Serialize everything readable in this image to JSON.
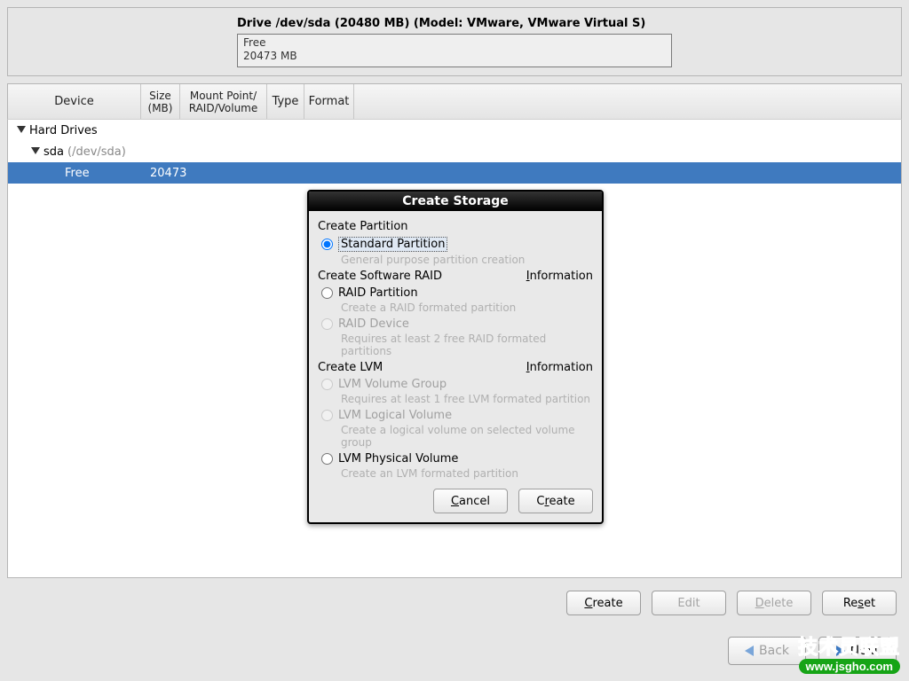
{
  "drive": {
    "title": "Drive /dev/sda (20480 MB) (Model: VMware, VMware Virtual S)",
    "box_line1": "Free",
    "box_line2": "20473 MB"
  },
  "columns": {
    "device": "Device",
    "size_l1": "Size",
    "size_l2": "(MB)",
    "mount_l1": "Mount Point/",
    "mount_l2": "RAID/Volume",
    "type": "Type",
    "format": "Format"
  },
  "tree": {
    "root": "Hard Drives",
    "sda": "sda",
    "sda_path": "(/dev/sda)",
    "free_label": "Free",
    "free_size": "20473"
  },
  "actions": {
    "create": "Create",
    "edit": "Edit",
    "delete": "Delete",
    "reset": "Reset"
  },
  "nav": {
    "back": "Back",
    "next": "Next"
  },
  "dialog": {
    "title": "Create Storage",
    "sections": {
      "partition": "Create Partition",
      "raid": "Create Software RAID",
      "lvm": "Create LVM",
      "info": "Information"
    },
    "options": {
      "standard": "Standard Partition",
      "standard_desc": "General purpose partition creation",
      "raid_partition": "RAID Partition",
      "raid_partition_desc": "Create a RAID formated partition",
      "raid_device": "RAID Device",
      "raid_device_desc": "Requires at least 2 free RAID formated partitions",
      "lvm_vg": "LVM Volume Group",
      "lvm_vg_desc": "Requires at least 1 free LVM formated partition",
      "lvm_lv": "LVM Logical Volume",
      "lvm_lv_desc": "Create a logical volume on selected volume group",
      "lvm_pv": "LVM Physical Volume",
      "lvm_pv_desc": "Create an LVM formated partition"
    },
    "buttons": {
      "cancel": "Cancel",
      "create": "Create"
    }
  },
  "watermark": {
    "cn": "技术员联盟",
    "url": "www.jsgho.com"
  }
}
